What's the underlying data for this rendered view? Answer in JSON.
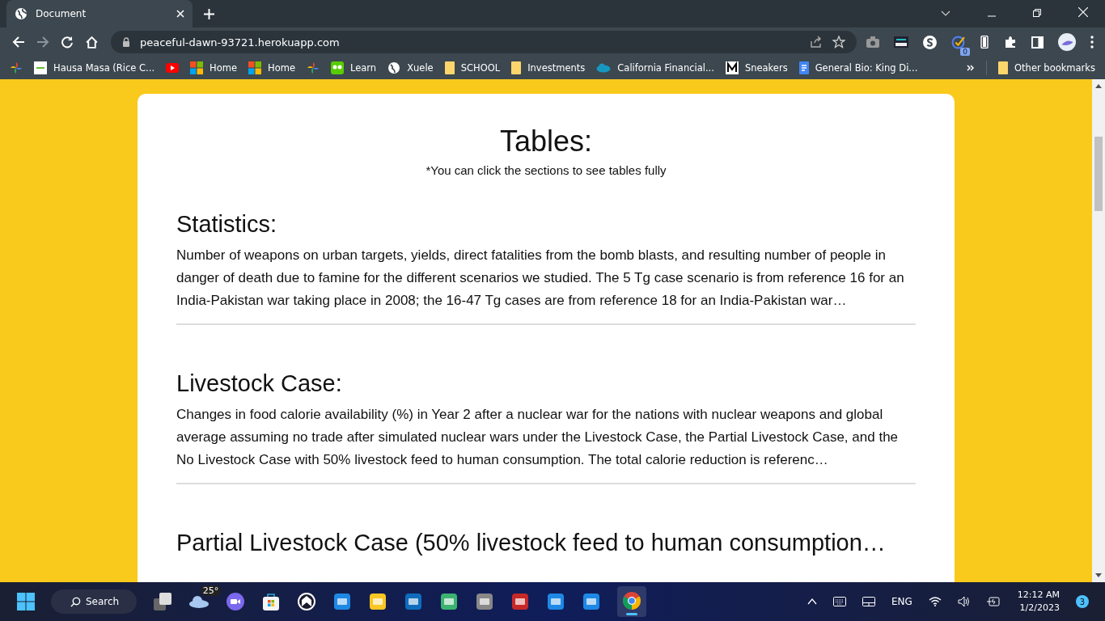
{
  "browser": {
    "tab": {
      "title": "Document",
      "selected": true
    },
    "address": "peaceful-dawn-93721.herokuapp.com",
    "extension_badge": "0",
    "bookmarks": [
      {
        "kind": "pinwheel"
      },
      {
        "kind": "site",
        "label": "Hausa Masa (Rice C..."
      },
      {
        "kind": "youtube"
      },
      {
        "kind": "ms",
        "label": "Home"
      },
      {
        "kind": "ms",
        "label": "Home"
      },
      {
        "kind": "pinwheel"
      },
      {
        "kind": "owl",
        "label": "Learn"
      },
      {
        "kind": "globe",
        "label": "Xuele"
      },
      {
        "kind": "folder",
        "label": "SCHOOL"
      },
      {
        "kind": "folder",
        "label": "Investments"
      },
      {
        "kind": "cloud",
        "label": "California Financial..."
      },
      {
        "kind": "mlogo",
        "label": "Sneakers"
      },
      {
        "kind": "doc",
        "label": "General Bio: King Di..."
      }
    ],
    "other_bookmarks": "Other bookmarks"
  },
  "page": {
    "title": "Tables:",
    "note": "*You can click the sections to see tables fully",
    "sections": [
      {
        "heading": "Statistics:",
        "text": "Number of weapons on urban targets, yields, direct fatalities from the bomb blasts, and resulting number of people in danger of death due to famine for the different scenarios we studied. The 5 Tg case scenario is from reference 16 for an India-Pakistan war taking place in 2008; the 16-47 Tg cases are from reference 18 for an India-Pakistan war…"
      },
      {
        "heading": "Livestock Case:",
        "text": "Changes in food calorie availability (%) in Year 2 after a nuclear war for the nations with nuclear weapons and global average assuming no trade after simulated nuclear wars under the Livestock Case, the Partial Livestock Case, and the No Livestock Case with 50% livestock feed to human consumption. The total calorie reduction is referenc…"
      },
      {
        "heading": "Partial Livestock Case (50% livestock feed to human consumption…"
      }
    ]
  },
  "taskbar": {
    "search": "Search",
    "weather": "25°",
    "language": "ENG",
    "time": "12:12 AM",
    "date": "1/2/2023",
    "notifications": "3"
  }
}
